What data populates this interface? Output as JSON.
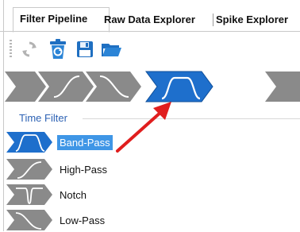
{
  "tabs": [
    {
      "label": "Filter Pipeline",
      "active": true
    },
    {
      "label": "Raw Data Explorer",
      "active": false
    },
    {
      "label": "Spike Explorer",
      "active": false
    }
  ],
  "toolbar": {
    "buttons": [
      {
        "name": "refresh-icon"
      },
      {
        "name": "recycle-bin-icon"
      },
      {
        "name": "save-icon"
      },
      {
        "name": "open-folder-icon"
      }
    ]
  },
  "pipeline": {
    "steps": [
      {
        "filter": "high-pass",
        "active": false
      },
      {
        "filter": "low-pass",
        "active": false
      },
      {
        "filter": "band-pass",
        "active": true
      }
    ]
  },
  "section": {
    "title": "Time Filter"
  },
  "filters": [
    {
      "label": "Band-Pass",
      "selected": true,
      "icon": "band-pass-icon"
    },
    {
      "label": "High-Pass",
      "selected": false,
      "icon": "high-pass-icon"
    },
    {
      "label": "Notch",
      "selected": false,
      "icon": "notch-icon"
    },
    {
      "label": "Low-Pass",
      "selected": false,
      "icon": "low-pass-icon"
    }
  ],
  "colors": {
    "accent": "#3f96e6",
    "chevron_gray": "#8a8a8a",
    "chevron_active": "#1e6fcc",
    "section_title": "#2d62b4",
    "arrow": "#e01e1e"
  }
}
